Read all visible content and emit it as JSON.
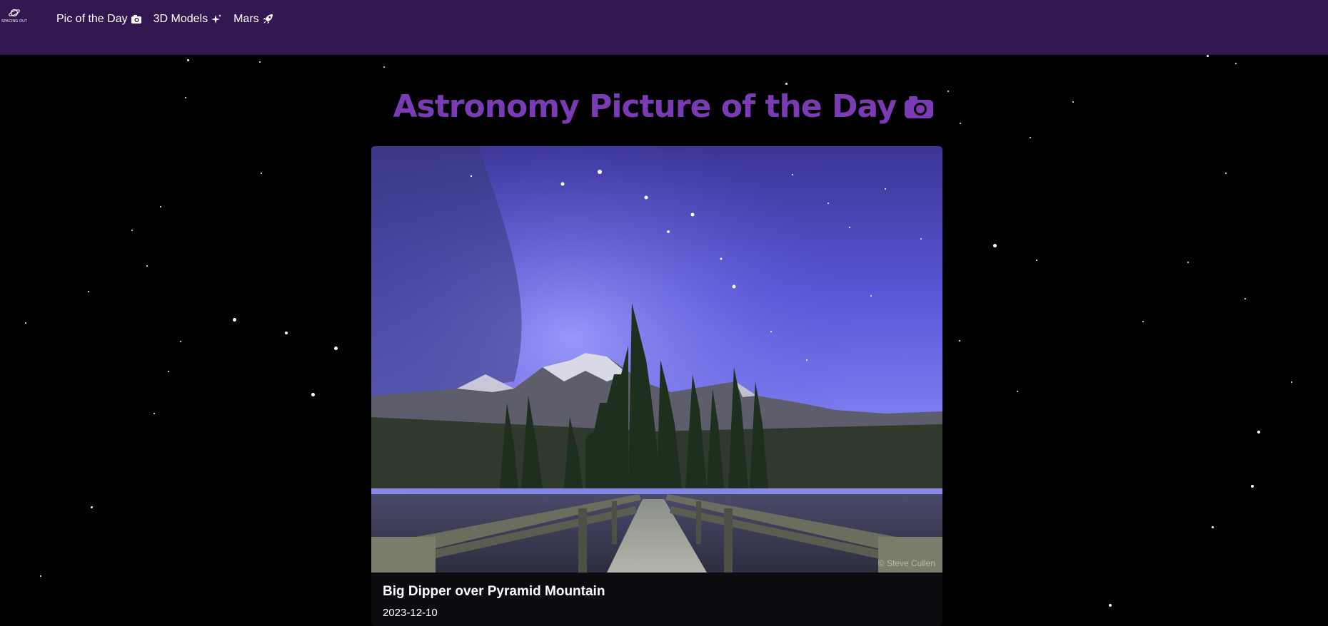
{
  "brand": {
    "text": "SPACING OUT",
    "icon": "planet-icon"
  },
  "nav": [
    {
      "label": "Pic of the Day",
      "icon": "camera-icon"
    },
    {
      "label": "3D Models",
      "icon": "sparkles-icon"
    },
    {
      "label": "Mars",
      "icon": "rocket-icon"
    }
  ],
  "page": {
    "title": "Astronomy Picture of the Day",
    "title_icon": "camera-icon"
  },
  "apod": {
    "title": "Big Dipper over Pyramid Mountain",
    "date": "2023-12-10",
    "credit": "© Steve Cullen"
  },
  "colors": {
    "navbar": "#331751",
    "title": "#7a3bb5",
    "background": "#000000",
    "card": "#0b0b10"
  }
}
